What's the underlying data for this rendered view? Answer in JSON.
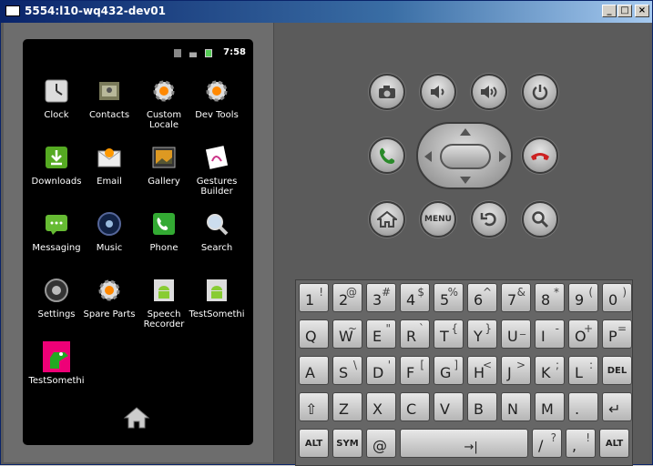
{
  "window": {
    "title": "5554:l10-wq432-dev01",
    "minimize_glyph": "_",
    "maximize_glyph": "□",
    "close_glyph": "×"
  },
  "status_bar": {
    "time": "7:58"
  },
  "apps": [
    {
      "label": "Clock",
      "icon": "clock-icon"
    },
    {
      "label": "Contacts",
      "icon": "contacts-icon"
    },
    {
      "label": "Custom\nLocale",
      "icon": "gear-icon"
    },
    {
      "label": "Dev Tools",
      "icon": "gear-icon"
    },
    {
      "label": "Downloads",
      "icon": "download-icon"
    },
    {
      "label": "Email",
      "icon": "email-icon"
    },
    {
      "label": "Gallery",
      "icon": "gallery-icon"
    },
    {
      "label": "Gestures\nBuilder",
      "icon": "gestures-icon"
    },
    {
      "label": "Messaging",
      "icon": "messaging-icon"
    },
    {
      "label": "Music",
      "icon": "music-icon"
    },
    {
      "label": "Phone",
      "icon": "phone-icon"
    },
    {
      "label": "Search",
      "icon": "search-icon"
    },
    {
      "label": "Settings",
      "icon": "settings-icon"
    },
    {
      "label": "Spare Parts",
      "icon": "gear-icon"
    },
    {
      "label": "Speech\nRecorder",
      "icon": "android-icon"
    },
    {
      "label": "TestSomethi",
      "icon": "android-icon"
    },
    {
      "label": "TestSomethi",
      "icon": "dino-icon"
    }
  ],
  "controls": {
    "menu_label": "MENU"
  },
  "keyboard": {
    "rows": [
      [
        {
          "m": "1",
          "a": "!"
        },
        {
          "m": "2",
          "a": "@"
        },
        {
          "m": "3",
          "a": "#"
        },
        {
          "m": "4",
          "a": "$"
        },
        {
          "m": "5",
          "a": "%"
        },
        {
          "m": "6",
          "a": "^"
        },
        {
          "m": "7",
          "a": "&"
        },
        {
          "m": "8",
          "a": "*"
        },
        {
          "m": "9",
          "a": "("
        },
        {
          "m": "0",
          "a": ")"
        }
      ],
      [
        {
          "m": "Q",
          "a": ""
        },
        {
          "m": "W",
          "a": "~"
        },
        {
          "m": "E",
          "a": "\""
        },
        {
          "m": "R",
          "a": "`"
        },
        {
          "m": "T",
          "a": "{"
        },
        {
          "m": "Y",
          "a": "}"
        },
        {
          "m": "U",
          "a": "_"
        },
        {
          "m": "I",
          "a": "-"
        },
        {
          "m": "O",
          "a": "+"
        },
        {
          "m": "P",
          "a": "="
        }
      ],
      [
        {
          "m": "A",
          "a": ""
        },
        {
          "m": "S",
          "a": "\\"
        },
        {
          "m": "D",
          "a": "'"
        },
        {
          "m": "F",
          "a": "["
        },
        {
          "m": "G",
          "a": "]"
        },
        {
          "m": "H",
          "a": "<"
        },
        {
          "m": "J",
          "a": ">"
        },
        {
          "m": "K",
          "a": ";"
        },
        {
          "m": "L",
          "a": ":"
        },
        {
          "m": "DEL",
          "a": ""
        }
      ],
      [
        {
          "m": "⇧",
          "a": ""
        },
        {
          "m": "Z",
          "a": ""
        },
        {
          "m": "X",
          "a": ""
        },
        {
          "m": "C",
          "a": ""
        },
        {
          "m": "V",
          "a": ""
        },
        {
          "m": "B",
          "a": ""
        },
        {
          "m": "N",
          "a": ""
        },
        {
          "m": "M",
          "a": ""
        },
        {
          "m": ".",
          "a": ""
        },
        {
          "m": "↵",
          "a": ""
        }
      ],
      [
        {
          "m": "ALT",
          "a": ""
        },
        {
          "m": "SYM",
          "a": ""
        },
        {
          "m": "@",
          "a": ""
        },
        {
          "m": "→|",
          "a": ""
        },
        {
          "m": "/",
          "a": "?"
        },
        {
          "m": ",",
          "a": "!"
        },
        {
          "m": "ALT",
          "a": ""
        }
      ]
    ]
  }
}
